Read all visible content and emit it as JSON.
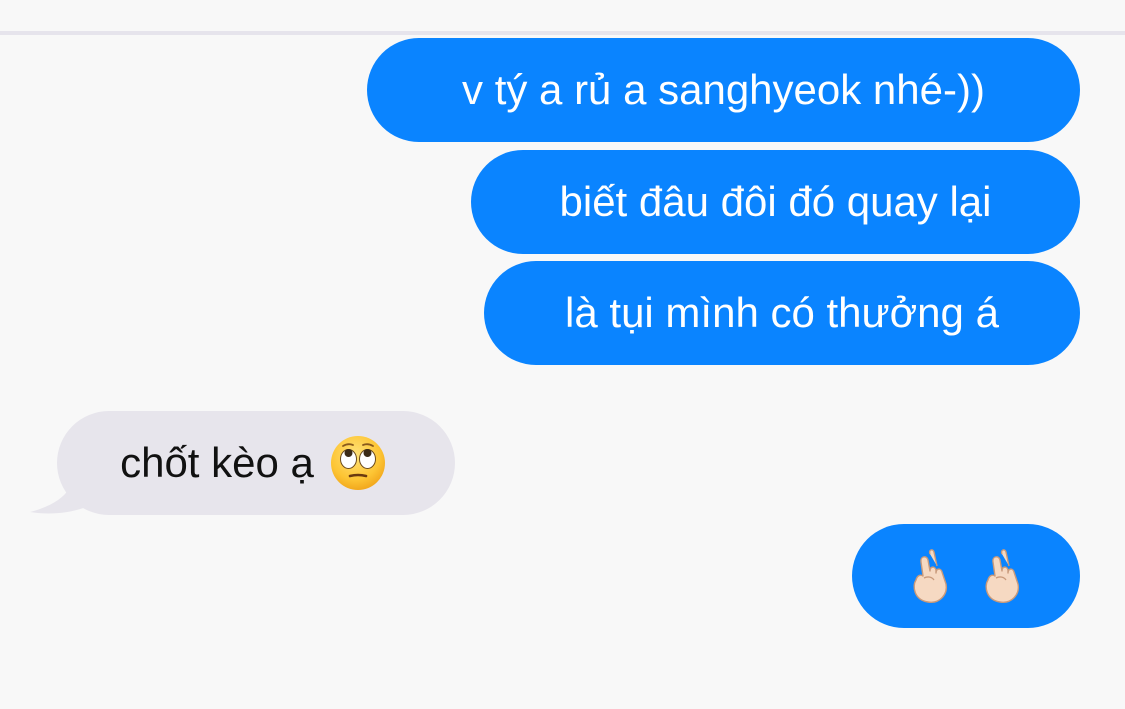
{
  "conversation": {
    "messages": [
      {
        "direction": "outgoing",
        "text": "v tý a rủ a sanghyeok nhé-))"
      },
      {
        "direction": "outgoing",
        "text": "biết đâu đôi đó quay lại"
      },
      {
        "direction": "outgoing",
        "text": "là tụi mình có thưởng á"
      },
      {
        "direction": "incoming",
        "text": "chốt kèo ạ",
        "emoji": "face-with-rolling-eyes-icon"
      },
      {
        "direction": "outgoing",
        "emoji": [
          "hand-with-index-and-thumb-crossed-icon",
          "hand-with-index-and-thumb-crossed-icon"
        ]
      }
    ]
  },
  "colors": {
    "background": "#f8f8f8",
    "outgoing_bubble": "#0a84ff",
    "incoming_bubble": "#e7e5ec",
    "divider": "#e6e4ec"
  }
}
